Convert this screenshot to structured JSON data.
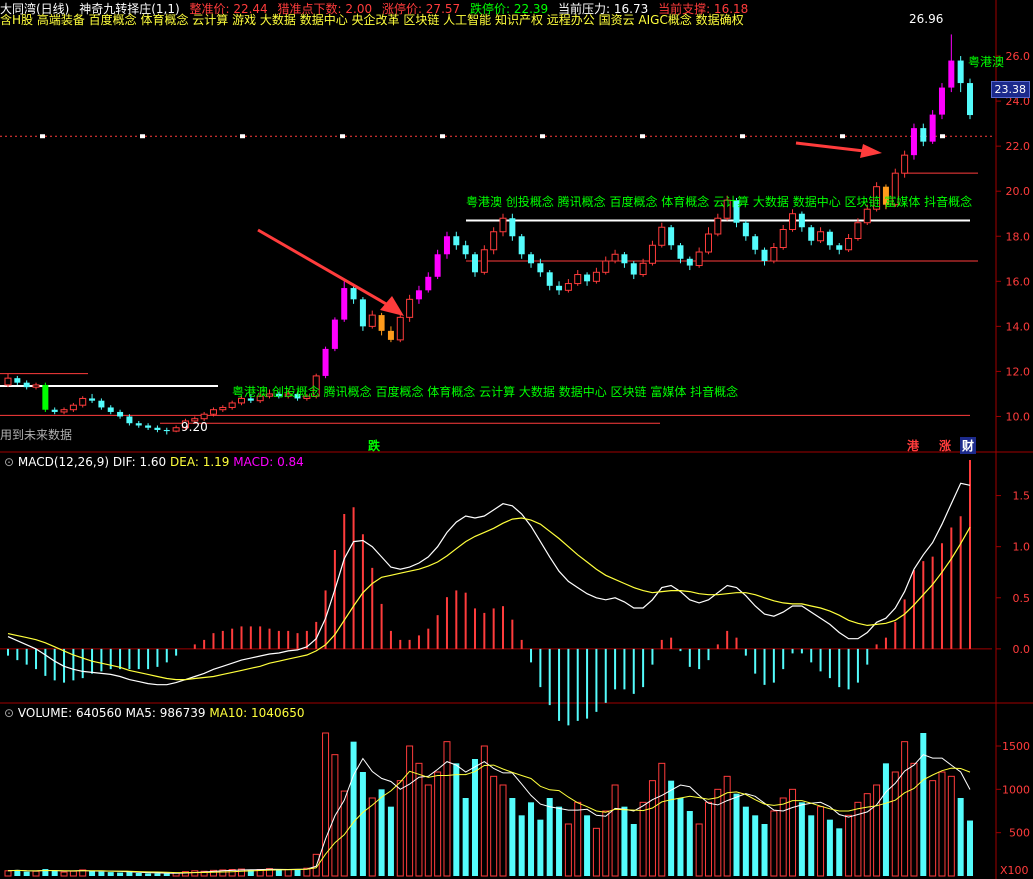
{
  "header": {
    "items": [
      "大同湾(日线)",
      "神奇九转择庄(1,1)",
      "整准价: 22.44",
      "猎准点下数: 2.00",
      "涨停价: 27.57",
      "跌停价: 22.39",
      "当前压力: 16.73",
      "当前支撑: 16.18"
    ],
    "concepts": "含H股 高端装备 百度概念 体育概念 云计算 游戏 大数据 数据中心 央企改革 区块链 人工智能 知识产权 远程办公 国资云 AIGC概念 数据确权"
  },
  "colors": {
    "up": "#ff3c3c",
    "down": "#54fcfc",
    "magenta": "#ff00ff",
    "orange": "#ff9c1c",
    "green": "#00ff00",
    "yellow": "#ffff3c",
    "white": "#ffffff",
    "grid": "#a00000"
  },
  "annotations": {
    "peak": "26.96",
    "low": "9.20",
    "future_note": "用到未来数据",
    "band_label_1": "粤港澳 创投概念 腾讯概念 百度概念 体育概念 云计算 大数据 数据中心 区块链 富媒体 抖音概念",
    "band_label_2": "粤港澳 创投概念 腾讯概念 百度概念 体育概念 云计算 大数据 数据中心 区块链 富媒体 抖音概念",
    "side_label": "粤港澳",
    "markers": {
      "die": "跌",
      "gang": "港",
      "zhang": "涨",
      "cai": "财"
    }
  },
  "panels": {
    "main": {
      "price_tag": "23.38",
      "yticks": [
        "26.0",
        "24.0",
        "22.0",
        "20.0",
        "18.0",
        "16.0",
        "14.0",
        "12.0",
        "10.0"
      ]
    },
    "macd": {
      "title": "MACD(12,26,9)",
      "dif_label": "DIF: 1.60",
      "dea_label": "DEA: 1.19",
      "macd_label": "MACD: 0.84",
      "yticks": [
        "1.5",
        "1.0",
        "0.5",
        "0.0"
      ]
    },
    "volume": {
      "title": "VOLUME: 640560",
      "ma5_label": "MA5: 986739",
      "ma10_label": "MA10: 1040650",
      "yticks": [
        "1500",
        "1000",
        "500"
      ],
      "unit": "X100"
    }
  },
  "chart_data": {
    "type": "candlestick",
    "price_range": [
      8.6,
      27.6
    ],
    "candles": [
      [
        11.4,
        11.7,
        11.9,
        11.3
      ],
      [
        11.7,
        11.5,
        11.8,
        11.4
      ],
      [
        11.5,
        11.3,
        11.6,
        11.2
      ],
      [
        11.3,
        11.4,
        11.5,
        11.2
      ],
      [
        11.4,
        10.3,
        11.5,
        10.2
      ],
      [
        10.3,
        10.2,
        10.4,
        10.1
      ],
      [
        10.2,
        10.3,
        10.4,
        10.1
      ],
      [
        10.3,
        10.5,
        10.6,
        10.2
      ],
      [
        10.5,
        10.8,
        10.9,
        10.4
      ],
      [
        10.8,
        10.7,
        11.0,
        10.6
      ],
      [
        10.7,
        10.4,
        10.8,
        10.3
      ],
      [
        10.4,
        10.2,
        10.5,
        10.1
      ],
      [
        10.2,
        10.0,
        10.3,
        9.9
      ],
      [
        10.0,
        9.7,
        10.1,
        9.6
      ],
      [
        9.7,
        9.6,
        9.8,
        9.5
      ],
      [
        9.6,
        9.5,
        9.7,
        9.4
      ],
      [
        9.5,
        9.4,
        9.6,
        9.3
      ],
      [
        9.4,
        9.35,
        9.5,
        9.2
      ],
      [
        9.35,
        9.5,
        9.6,
        9.3
      ],
      [
        9.5,
        9.8,
        9.9,
        9.4
      ],
      [
        9.8,
        9.9,
        10.0,
        9.7
      ],
      [
        9.9,
        10.1,
        10.2,
        9.8
      ],
      [
        10.1,
        10.3,
        10.4,
        10.0
      ],
      [
        10.3,
        10.4,
        10.5,
        10.2
      ],
      [
        10.4,
        10.6,
        10.7,
        10.3
      ],
      [
        10.6,
        10.8,
        10.9,
        10.5
      ],
      [
        10.8,
        10.7,
        11.0,
        10.6
      ],
      [
        10.7,
        10.9,
        11.1,
        10.6
      ],
      [
        10.9,
        11.0,
        11.2,
        10.8
      ],
      [
        11.0,
        10.9,
        11.1,
        10.8
      ],
      [
        10.9,
        11.0,
        11.2,
        10.8
      ],
      [
        11.0,
        10.8,
        11.1,
        10.7
      ],
      [
        10.8,
        10.9,
        11.0,
        10.7
      ],
      [
        10.9,
        11.8,
        11.9,
        10.8
      ],
      [
        11.8,
        13.0,
        13.1,
        11.7
      ],
      [
        13.0,
        14.3,
        14.4,
        12.9
      ],
      [
        14.3,
        15.7,
        16.0,
        14.2
      ],
      [
        15.7,
        15.2,
        15.9,
        15.0
      ],
      [
        15.2,
        14.0,
        15.3,
        13.8
      ],
      [
        14.0,
        14.5,
        14.7,
        13.9
      ],
      [
        14.5,
        13.8,
        14.6,
        13.6
      ],
      [
        13.8,
        13.4,
        14.0,
        13.3
      ],
      [
        13.4,
        14.4,
        14.5,
        13.3
      ],
      [
        14.4,
        15.2,
        15.4,
        14.2
      ],
      [
        15.2,
        15.6,
        15.8,
        15.0
      ],
      [
        15.6,
        16.2,
        16.4,
        15.5
      ],
      [
        16.2,
        17.2,
        17.4,
        16.1
      ],
      [
        17.2,
        18.0,
        18.2,
        17.0
      ],
      [
        18.0,
        17.6,
        18.2,
        17.4
      ],
      [
        17.6,
        17.2,
        17.8,
        17.0
      ],
      [
        17.2,
        16.4,
        17.3,
        16.2
      ],
      [
        16.4,
        17.4,
        17.6,
        16.3
      ],
      [
        17.4,
        18.2,
        18.4,
        17.2
      ],
      [
        18.2,
        18.8,
        19.0,
        18.0
      ],
      [
        18.8,
        18.0,
        19.0,
        17.8
      ],
      [
        18.0,
        17.2,
        18.1,
        17.0
      ],
      [
        17.2,
        16.8,
        17.3,
        16.6
      ],
      [
        16.8,
        16.4,
        17.0,
        16.2
      ],
      [
        16.4,
        15.8,
        16.5,
        15.6
      ],
      [
        15.8,
        15.6,
        16.0,
        15.4
      ],
      [
        15.6,
        15.9,
        16.1,
        15.5
      ],
      [
        15.9,
        16.3,
        16.5,
        15.8
      ],
      [
        16.3,
        16.0,
        16.4,
        15.8
      ],
      [
        16.0,
        16.4,
        16.6,
        15.9
      ],
      [
        16.4,
        16.9,
        17.1,
        16.3
      ],
      [
        16.9,
        17.2,
        17.4,
        16.8
      ],
      [
        17.2,
        16.8,
        17.3,
        16.6
      ],
      [
        16.8,
        16.3,
        16.9,
        16.1
      ],
      [
        16.3,
        16.8,
        17.0,
        16.2
      ],
      [
        16.8,
        17.6,
        17.8,
        16.7
      ],
      [
        17.6,
        18.4,
        18.6,
        17.5
      ],
      [
        18.4,
        17.6,
        18.5,
        17.4
      ],
      [
        17.6,
        17.0,
        17.7,
        16.8
      ],
      [
        17.0,
        16.7,
        17.1,
        16.5
      ],
      [
        16.7,
        17.3,
        17.5,
        16.6
      ],
      [
        17.3,
        18.1,
        18.4,
        17.2
      ],
      [
        18.1,
        18.8,
        19.0,
        18.0
      ],
      [
        18.8,
        19.6,
        19.8,
        18.7
      ],
      [
        19.6,
        18.6,
        19.7,
        18.4
      ],
      [
        18.6,
        18.0,
        18.7,
        17.8
      ],
      [
        18.0,
        17.4,
        18.1,
        17.2
      ],
      [
        17.4,
        16.9,
        17.5,
        16.7
      ],
      [
        16.9,
        17.5,
        17.7,
        16.8
      ],
      [
        17.5,
        18.3,
        18.5,
        17.4
      ],
      [
        18.3,
        19.0,
        19.2,
        18.2
      ],
      [
        19.0,
        18.4,
        19.1,
        18.2
      ],
      [
        18.4,
        17.8,
        18.5,
        17.6
      ],
      [
        17.8,
        18.2,
        18.4,
        17.7
      ],
      [
        18.2,
        17.6,
        18.3,
        17.4
      ],
      [
        17.6,
        17.4,
        17.7,
        17.2
      ],
      [
        17.4,
        17.9,
        18.1,
        17.3
      ],
      [
        17.9,
        18.6,
        18.8,
        17.8
      ],
      [
        18.6,
        19.2,
        19.4,
        18.5
      ],
      [
        19.2,
        20.2,
        20.4,
        19.1
      ],
      [
        20.2,
        19.4,
        20.3,
        19.2
      ],
      [
        19.4,
        20.8,
        21.0,
        19.3
      ],
      [
        20.8,
        21.6,
        21.8,
        20.6
      ],
      [
        21.6,
        22.8,
        23.0,
        21.4
      ],
      [
        22.8,
        22.2,
        23.0,
        22.0
      ],
      [
        22.2,
        23.4,
        23.6,
        22.1
      ],
      [
        23.4,
        24.6,
        24.8,
        23.2
      ],
      [
        24.6,
        25.8,
        26.96,
        24.4
      ],
      [
        25.8,
        24.8,
        26.0,
        24.4
      ],
      [
        24.8,
        23.38,
        25.0,
        23.2
      ]
    ],
    "macd": {
      "dif": [
        0.12,
        0.08,
        0.04,
        0.0,
        -0.06,
        -0.12,
        -0.17,
        -0.2,
        -0.22,
        -0.23,
        -0.24,
        -0.25,
        -0.27,
        -0.3,
        -0.32,
        -0.34,
        -0.35,
        -0.35,
        -0.33,
        -0.3,
        -0.27,
        -0.24,
        -0.2,
        -0.17,
        -0.14,
        -0.11,
        -0.09,
        -0.07,
        -0.05,
        -0.04,
        -0.02,
        -0.01,
        0.02,
        0.1,
        0.3,
        0.58,
        0.88,
        1.05,
        1.06,
        1.0,
        0.9,
        0.8,
        0.78,
        0.8,
        0.84,
        0.9,
        1.0,
        1.14,
        1.24,
        1.3,
        1.28,
        1.3,
        1.36,
        1.42,
        1.4,
        1.32,
        1.2,
        1.05,
        0.9,
        0.76,
        0.66,
        0.6,
        0.54,
        0.5,
        0.48,
        0.5,
        0.46,
        0.4,
        0.4,
        0.48,
        0.6,
        0.62,
        0.56,
        0.48,
        0.45,
        0.48,
        0.55,
        0.62,
        0.6,
        0.52,
        0.42,
        0.34,
        0.32,
        0.36,
        0.42,
        0.42,
        0.36,
        0.3,
        0.24,
        0.16,
        0.1,
        0.1,
        0.16,
        0.26,
        0.3,
        0.4,
        0.56,
        0.78,
        0.92,
        1.04,
        1.22,
        1.42,
        1.62,
        1.6
      ],
      "dea": [
        0.15,
        0.13,
        0.11,
        0.09,
        0.06,
        0.02,
        -0.02,
        -0.06,
        -0.09,
        -0.12,
        -0.14,
        -0.16,
        -0.18,
        -0.21,
        -0.23,
        -0.25,
        -0.27,
        -0.29,
        -0.3,
        -0.3,
        -0.29,
        -0.28,
        -0.27,
        -0.25,
        -0.23,
        -0.21,
        -0.19,
        -0.17,
        -0.14,
        -0.12,
        -0.1,
        -0.08,
        -0.06,
        -0.02,
        0.04,
        0.14,
        0.28,
        0.42,
        0.55,
        0.64,
        0.7,
        0.72,
        0.74,
        0.76,
        0.78,
        0.81,
        0.85,
        0.91,
        0.98,
        1.05,
        1.1,
        1.14,
        1.18,
        1.23,
        1.27,
        1.28,
        1.26,
        1.22,
        1.15,
        1.08,
        1.0,
        0.92,
        0.85,
        0.78,
        0.72,
        0.68,
        0.64,
        0.6,
        0.57,
        0.55,
        0.56,
        0.57,
        0.57,
        0.56,
        0.54,
        0.53,
        0.53,
        0.54,
        0.55,
        0.55,
        0.53,
        0.5,
        0.47,
        0.45,
        0.44,
        0.44,
        0.42,
        0.4,
        0.37,
        0.33,
        0.28,
        0.25,
        0.23,
        0.24,
        0.25,
        0.28,
        0.34,
        0.43,
        0.53,
        0.63,
        0.75,
        0.88,
        1.03,
        1.19
      ],
      "hist": [
        -0.03,
        -0.05,
        -0.07,
        -0.09,
        -0.12,
        -0.14,
        -0.15,
        -0.14,
        -0.13,
        -0.11,
        -0.1,
        -0.09,
        -0.09,
        -0.09,
        -0.09,
        -0.09,
        -0.08,
        -0.06,
        -0.03,
        0.0,
        0.02,
        0.04,
        0.07,
        0.08,
        0.09,
        0.1,
        0.1,
        0.1,
        0.09,
        0.08,
        0.08,
        0.07,
        0.08,
        0.12,
        0.26,
        0.44,
        0.6,
        0.63,
        0.51,
        0.36,
        0.2,
        0.08,
        0.04,
        0.04,
        0.06,
        0.09,
        0.15,
        0.23,
        0.26,
        0.25,
        0.18,
        0.16,
        0.18,
        0.19,
        0.13,
        0.04,
        -0.06,
        -0.17,
        -0.25,
        -0.32,
        -0.34,
        -0.32,
        -0.31,
        -0.28,
        -0.24,
        -0.18,
        -0.18,
        -0.2,
        -0.17,
        -0.07,
        0.04,
        0.05,
        -0.01,
        -0.08,
        -0.09,
        -0.05,
        0.02,
        0.08,
        0.05,
        -0.03,
        -0.11,
        -0.16,
        -0.15,
        -0.09,
        -0.02,
        -0.02,
        -0.06,
        -0.1,
        -0.13,
        -0.17,
        -0.18,
        -0.15,
        -0.07,
        0.02,
        0.05,
        0.12,
        0.22,
        0.35,
        0.39,
        0.41,
        0.47,
        0.54,
        0.59,
        0.84
      ]
    },
    "volume": [
      60,
      70,
      50,
      55,
      80,
      60,
      45,
      55,
      70,
      60,
      50,
      45,
      40,
      45,
      35,
      30,
      30,
      28,
      35,
      50,
      60,
      55,
      65,
      70,
      75,
      80,
      70,
      75,
      85,
      70,
      75,
      80,
      90,
      250,
      1650,
      1400,
      980,
      1550,
      1200,
      900,
      1000,
      800,
      1100,
      1500,
      1300,
      1050,
      1200,
      1550,
      1300,
      900,
      1350,
      1500,
      1150,
      1050,
      900,
      700,
      850,
      650,
      900,
      800,
      600,
      850,
      700,
      550,
      750,
      1050,
      800,
      600,
      850,
      1100,
      1300,
      1100,
      900,
      750,
      600,
      850,
      1000,
      1150,
      950,
      800,
      700,
      600,
      750,
      900,
      1000,
      850,
      700,
      800,
      650,
      550,
      700,
      850,
      950,
      1050,
      1300,
      1200,
      1550,
      1300,
      1650,
      1100,
      1200,
      1150,
      900,
      640
    ]
  }
}
